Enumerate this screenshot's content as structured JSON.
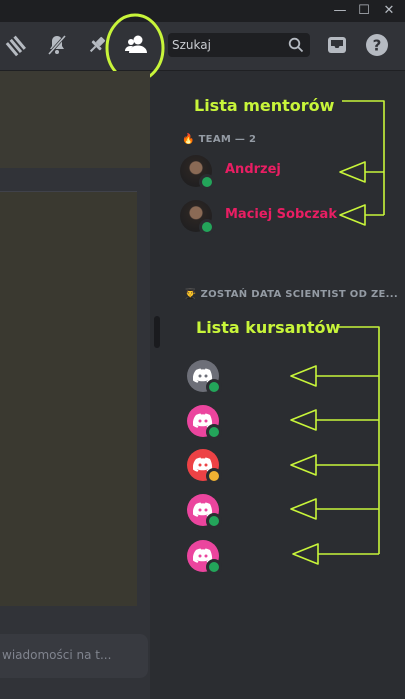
{
  "search": {
    "placeholder": "Szukaj"
  },
  "members": {
    "categories": [
      {
        "emoji": "🔥",
        "label": "TEAM — 2"
      },
      {
        "emoji": "👨‍🎓",
        "label": "ZOSTAŃ DATA SCIENTIST OD ZE..."
      }
    ],
    "mentors": [
      {
        "name": "Andrzej",
        "status": "online"
      },
      {
        "name": "Maciej Sobczak",
        "status": "online"
      }
    ],
    "students": [
      {
        "avatar_color": "#6d6f78",
        "status": "online"
      },
      {
        "avatar_color": "#eb459e",
        "status": "online"
      },
      {
        "avatar_color": "#ed4245",
        "status": "idle"
      },
      {
        "avatar_color": "#eb459e",
        "status": "online"
      },
      {
        "avatar_color": "#eb459e",
        "status": "online"
      }
    ]
  },
  "annotations": {
    "mentors_label": "Lista mentorów",
    "students_label": "Lista kursantów",
    "color": "#c8f53a"
  },
  "chat": {
    "placeholder": "wiadomości na t..."
  },
  "icons": [
    "minimize-icon",
    "maximize-icon",
    "close-icon",
    "threads-icon",
    "mute-bell-icon",
    "pin-icon",
    "member-list-icon",
    "search-icon",
    "inbox-icon",
    "help-icon",
    "discord-logo-icon"
  ]
}
